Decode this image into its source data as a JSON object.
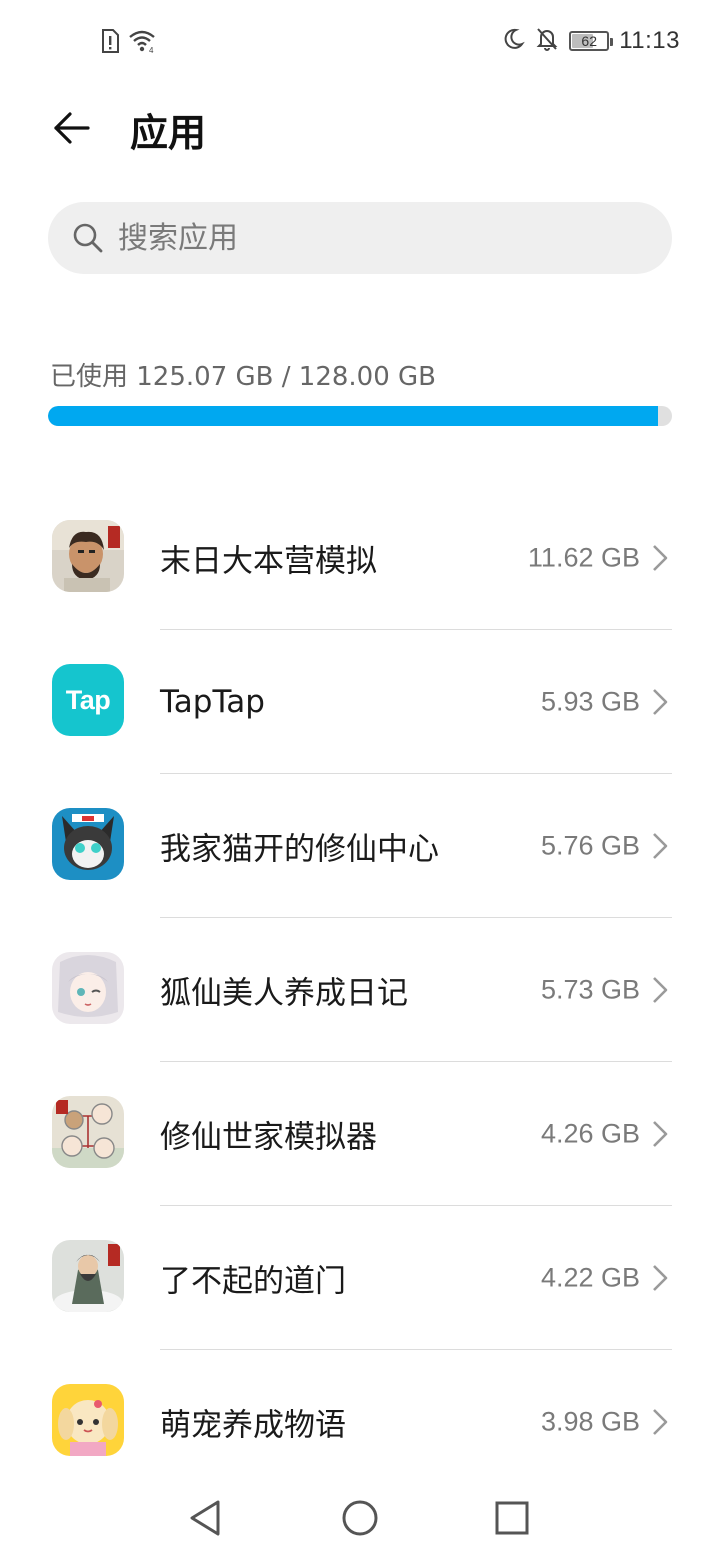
{
  "status_bar": {
    "time": "11:13",
    "battery_level": "62",
    "battery_percent": 62,
    "left_icons": [
      "sim-alert-icon",
      "wifi-icon"
    ],
    "right_icons": [
      "moon-icon",
      "bell-off-icon",
      "battery-icon"
    ]
  },
  "header": {
    "title": "应用",
    "back_icon": "arrow-left-icon"
  },
  "search": {
    "placeholder": "搜索应用",
    "icon": "search-icon"
  },
  "storage": {
    "label": "已使用 125.07 GB / 128.00 GB",
    "used_fraction": 0.977,
    "bar_color": "#00a8f0"
  },
  "apps": [
    {
      "name": "末日大本营模拟",
      "size": "11.62 GB",
      "icon": "doomsday-base-app-icon"
    },
    {
      "name": "TapTap",
      "size": "5.93 GB",
      "icon": "taptap-app-icon",
      "icon_text": "Tap"
    },
    {
      "name": "我家猫开的修仙中心",
      "size": "5.76 GB",
      "icon": "cat-cultivation-app-icon"
    },
    {
      "name": "狐仙美人养成日记",
      "size": "5.73 GB",
      "icon": "fox-fairy-app-icon"
    },
    {
      "name": "修仙世家模拟器",
      "size": "4.26 GB",
      "icon": "cultivation-family-app-icon"
    },
    {
      "name": "了不起的道门",
      "size": "4.22 GB",
      "icon": "taoist-sect-app-icon"
    },
    {
      "name": "萌宠养成物语",
      "size": "3.98 GB",
      "icon": "cute-pet-app-icon"
    }
  ],
  "nav_bar": {
    "buttons": [
      "back-triangle-icon",
      "home-circle-icon",
      "recents-square-icon"
    ]
  },
  "colors": {
    "accent": "#00a8f0",
    "taptap": "#15c5ce"
  }
}
